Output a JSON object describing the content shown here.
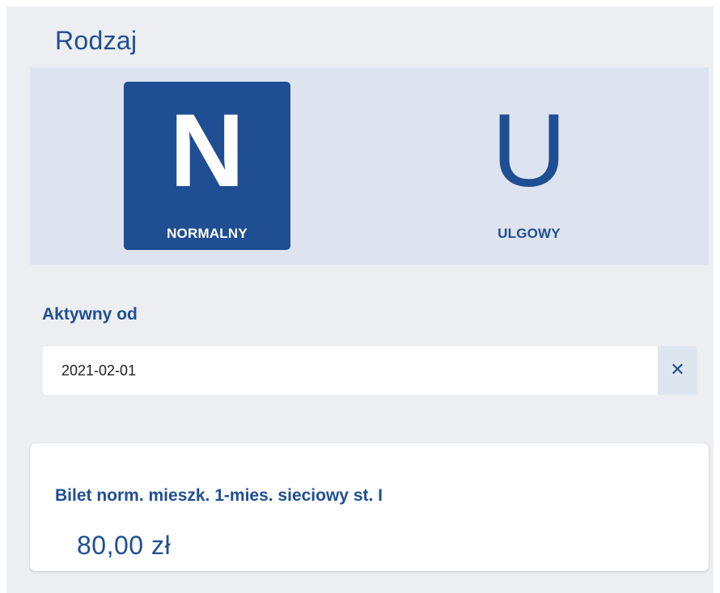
{
  "section": {
    "title": "Rodzaj"
  },
  "ticket_types": [
    {
      "letter": "N",
      "label": "NORMALNY",
      "selected": true
    },
    {
      "letter": "U",
      "label": "ULGOWY",
      "selected": false
    }
  ],
  "active_from": {
    "label": "Aktywny od",
    "value": "2021-02-01",
    "clear_icon": "close-icon"
  },
  "ticket": {
    "name": "Bilet norm. mieszk. 1-mies. sieciowy st. I",
    "price": "80,00 zł"
  },
  "colors": {
    "brand": "#1f4f92",
    "panel_bg": "#eceef1",
    "band_bg": "#dee4ef"
  }
}
